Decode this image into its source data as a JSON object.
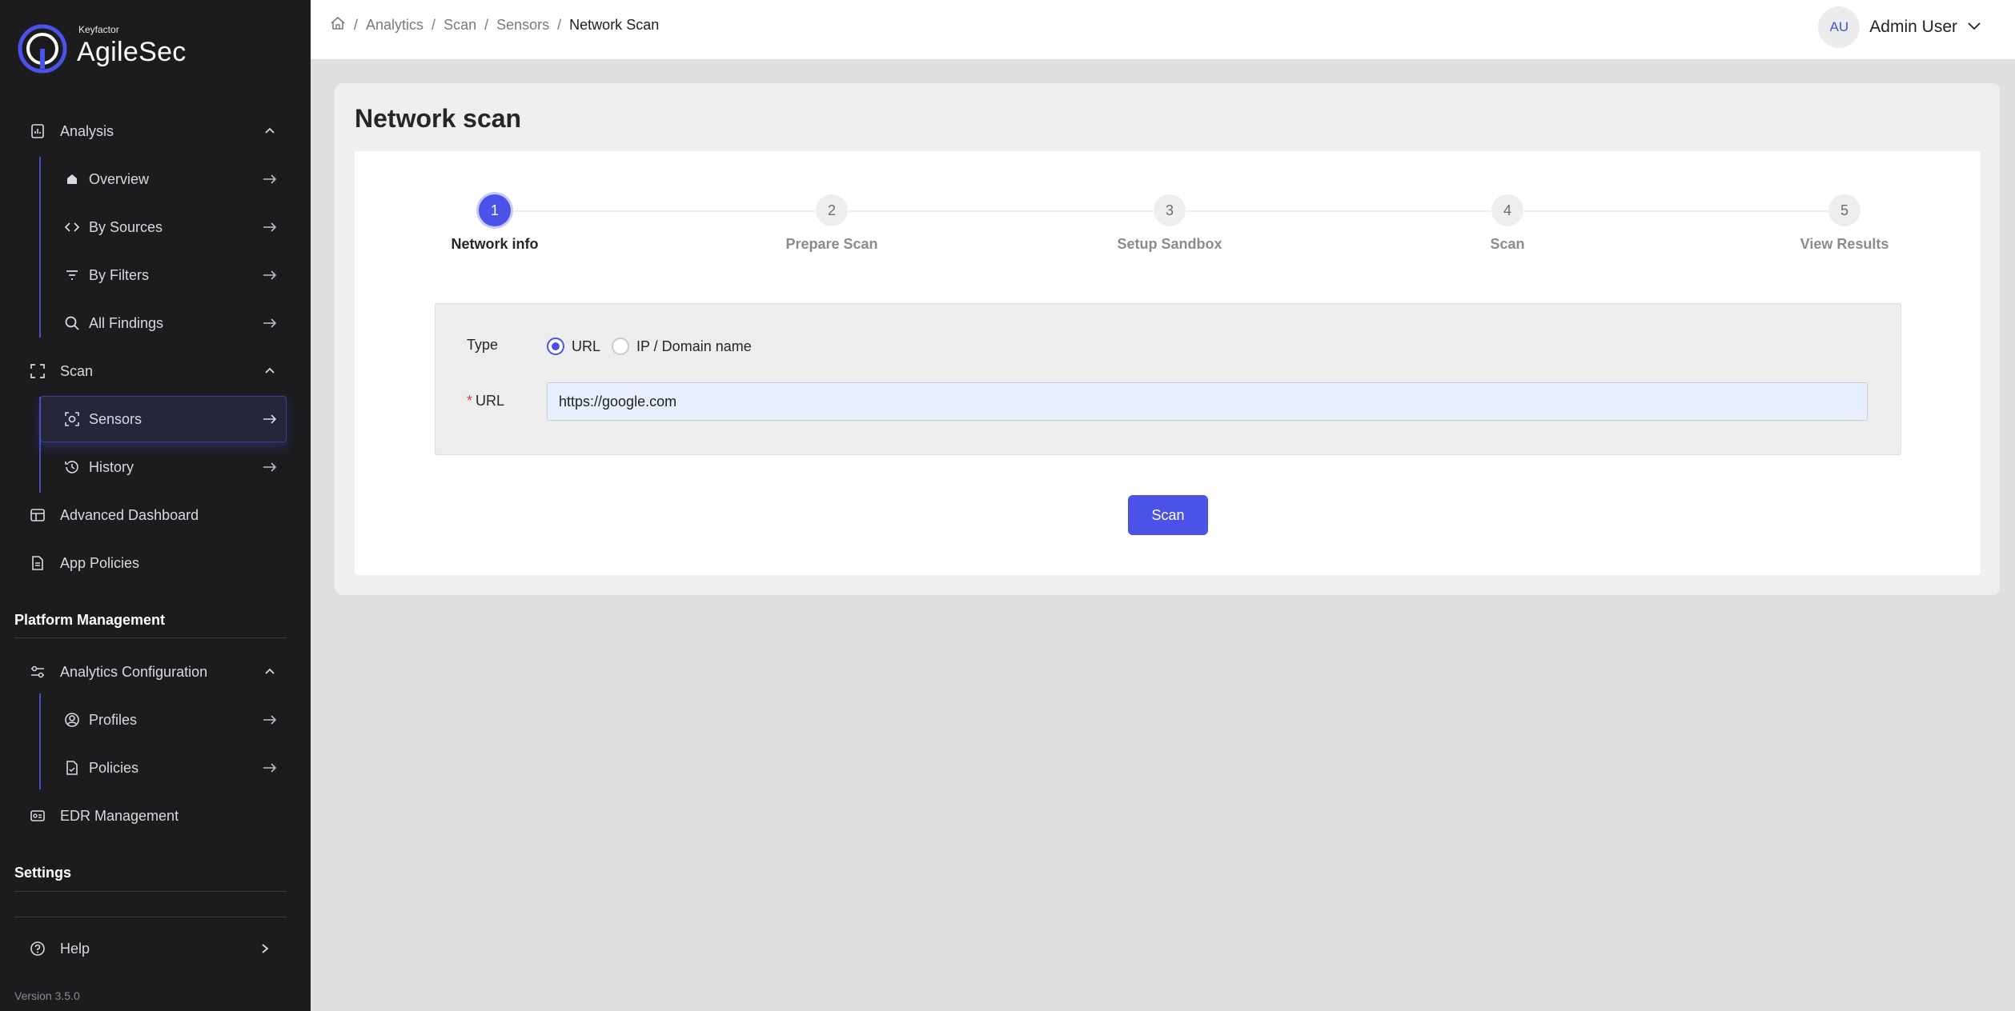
{
  "brand": {
    "small": "Keyfactor",
    "name": "AgileSec"
  },
  "sidebar": {
    "analysis": {
      "label": "Analysis",
      "items": [
        {
          "label": "Overview"
        },
        {
          "label": "By Sources"
        },
        {
          "label": "By Filters"
        },
        {
          "label": "All Findings"
        }
      ]
    },
    "scan": {
      "label": "Scan",
      "items": [
        {
          "label": "Sensors"
        },
        {
          "label": "History"
        }
      ]
    },
    "advanced_dashboard": "Advanced Dashboard",
    "app_policies": "App Policies",
    "platform_title": "Platform Management",
    "analytics_config": {
      "label": "Analytics Configuration",
      "items": [
        {
          "label": "Profiles"
        },
        {
          "label": "Policies"
        }
      ]
    },
    "edr": "EDR Management",
    "settings_title": "Settings",
    "help": "Help",
    "version": "Version 3.5.0"
  },
  "breadcrumb": {
    "items": [
      "Analytics",
      "Scan",
      "Sensors"
    ],
    "current": "Network Scan"
  },
  "user": {
    "initials": "AU",
    "name": "Admin User"
  },
  "page": {
    "title": "Network scan"
  },
  "steps": [
    {
      "num": "1",
      "label": "Network info"
    },
    {
      "num": "2",
      "label": "Prepare Scan"
    },
    {
      "num": "3",
      "label": "Setup Sandbox"
    },
    {
      "num": "4",
      "label": "Scan"
    },
    {
      "num": "5",
      "label": "View Results"
    }
  ],
  "form": {
    "type_label": "Type",
    "type_options": [
      "URL",
      "IP / Domain name"
    ],
    "type_selected": "URL",
    "required_mark": "*",
    "url_label": "URL",
    "url_value": "https://google.com",
    "submit_label": "Scan"
  },
  "colors": {
    "accent": "#4a52e8",
    "sidebar_bg": "#1c1c1e",
    "required": "#e0393e"
  }
}
